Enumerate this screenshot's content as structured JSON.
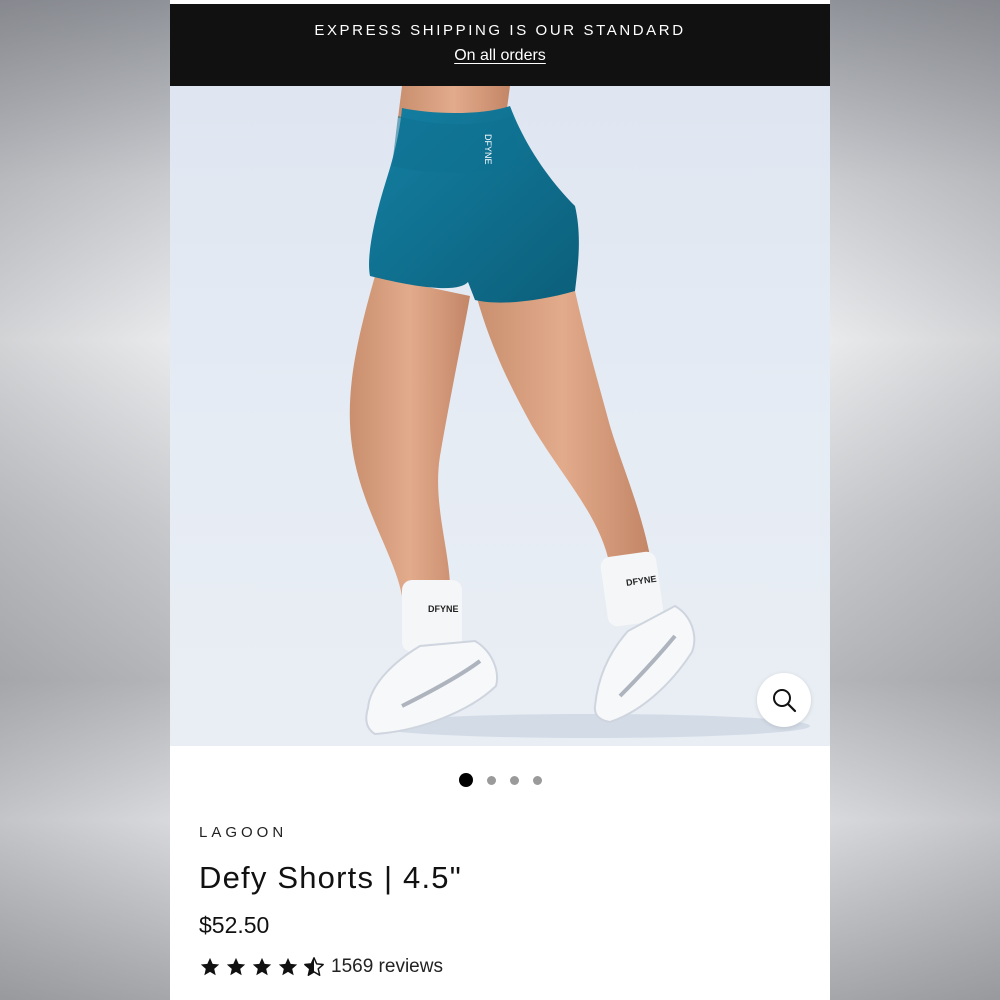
{
  "announcement": {
    "headline": "EXPRESS SHIPPING IS OUR STANDARD",
    "link_label": "On all orders"
  },
  "gallery": {
    "image_subject": "model wearing lagoon high-waist seamless shorts with white crew socks and white running sneakers",
    "sock_brand_text": "DFYNE",
    "waistband_brand_text": "DFYNE",
    "zoom_icon": "magnifier-icon",
    "slide_count": 4,
    "active_slide": 1
  },
  "product": {
    "variant": "LAGOON",
    "title": "Defy Shorts | 4.5\"",
    "price": "$52.50",
    "rating": 4.5,
    "review_label": "1569 reviews"
  },
  "colors": {
    "announcement_bg": "#111111",
    "shorts": "#0f6f8e",
    "background": "#e3e9f2"
  }
}
